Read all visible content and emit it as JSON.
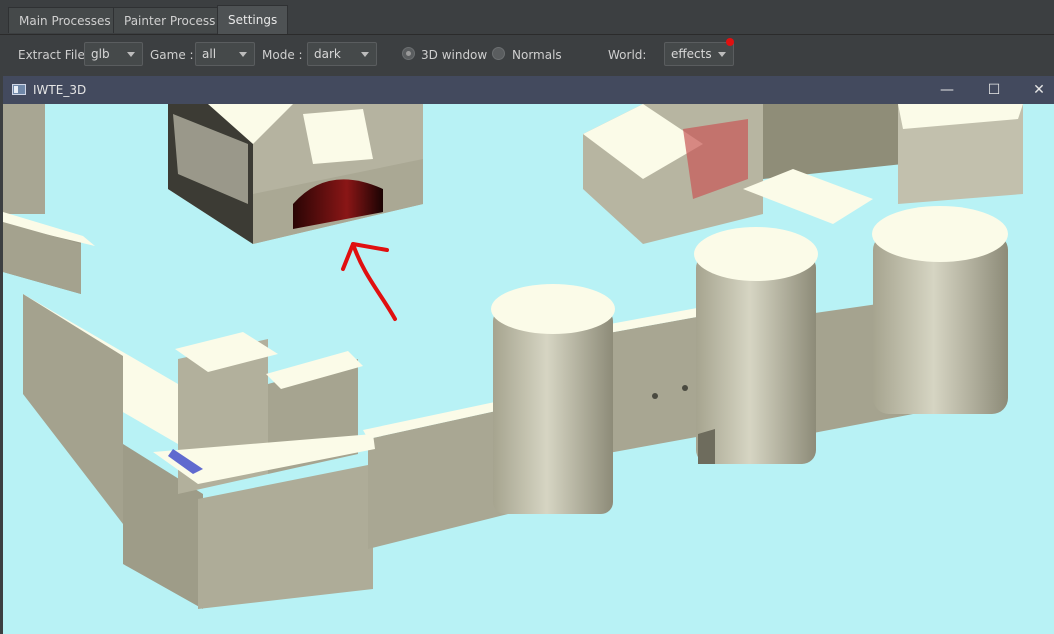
{
  "tabs": [
    {
      "label": "Main Processes"
    },
    {
      "label": "Painter Process"
    },
    {
      "label": "Settings"
    }
  ],
  "toolbar": {
    "extract_label": "Extract File",
    "extract_value": "glb",
    "game_label": "Game :",
    "game_value": "all",
    "mode_label": "Mode :",
    "mode_value": "dark",
    "radio_3d_label": "3D window",
    "radio_normals_label": "Normals",
    "world_label": "World:",
    "world_value": "effects"
  },
  "window": {
    "title": "IWTE_3D",
    "minimize": "—",
    "maximize": "☐",
    "close": "✕"
  },
  "colors": {
    "sky": "#b8f2f5",
    "stone_side": "#a9a794",
    "stone_top": "#fbfbe8",
    "annotation": "#e01010"
  }
}
